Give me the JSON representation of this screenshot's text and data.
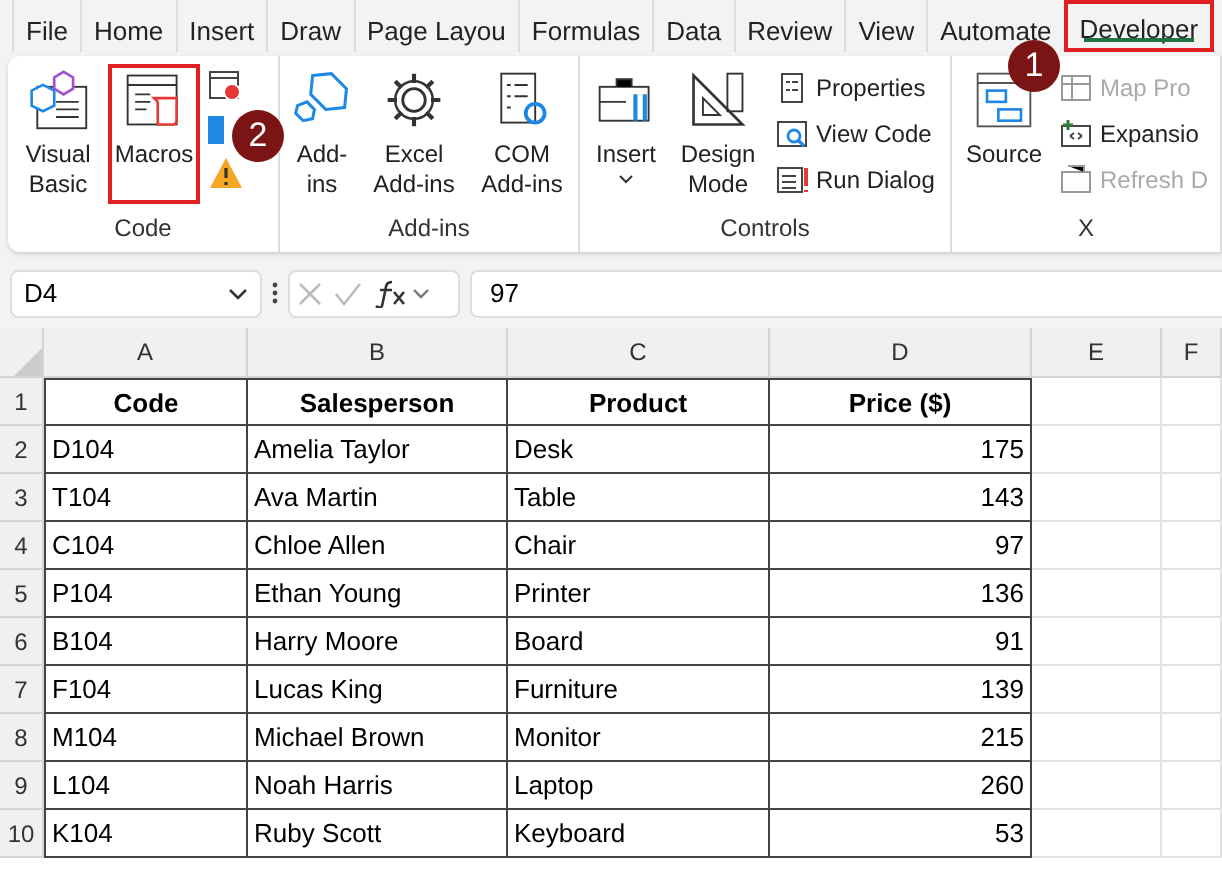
{
  "ribbon_tabs": [
    {
      "label": "File",
      "selected": false
    },
    {
      "label": "Home",
      "selected": false
    },
    {
      "label": "Insert",
      "selected": false
    },
    {
      "label": "Draw",
      "selected": false
    },
    {
      "label": "Page Layou",
      "selected": false
    },
    {
      "label": "Formulas",
      "selected": false
    },
    {
      "label": "Data",
      "selected": false
    },
    {
      "label": "Review",
      "selected": false
    },
    {
      "label": "View",
      "selected": false
    },
    {
      "label": "Automate",
      "selected": false
    },
    {
      "label": "Developer",
      "selected": true,
      "highlighted": true,
      "callout": "1"
    }
  ],
  "ribbon_groups": [
    {
      "label": "Code",
      "items": [
        {
          "kind": "large",
          "label": "Visual Basic"
        },
        {
          "kind": "large",
          "label": "Macros",
          "highlighted": true,
          "callout": "2"
        },
        {
          "kind": "iconstack"
        }
      ]
    },
    {
      "label": "Add-ins",
      "items": [
        {
          "kind": "large",
          "label": "Add-ins"
        },
        {
          "kind": "large",
          "label": "Excel Add-ins"
        },
        {
          "kind": "large",
          "label": "COM Add-ins"
        }
      ]
    },
    {
      "label": "Controls",
      "items": [
        {
          "kind": "large",
          "label": "Insert",
          "dropdown": true
        },
        {
          "kind": "large",
          "label": "Design Mode"
        },
        {
          "kind": "small",
          "entries": [
            {
              "label": "Properties",
              "disabled": false
            },
            {
              "label": "View Code",
              "disabled": false
            },
            {
              "label": "Run Dialog",
              "disabled": false
            }
          ]
        }
      ]
    },
    {
      "label": "X",
      "items": [
        {
          "kind": "large",
          "label": "Source"
        },
        {
          "kind": "small",
          "entries": [
            {
              "label": "Map Pro",
              "disabled": true
            },
            {
              "label": "Expansio",
              "disabled": false
            },
            {
              "label": "Refresh D",
              "disabled": true
            }
          ]
        }
      ]
    }
  ],
  "formula_bar": {
    "name_box": "D4",
    "formula": "97"
  },
  "sheet": {
    "columns": [
      "A",
      "B",
      "C",
      "D",
      "E",
      "F"
    ],
    "rows": [
      {
        "number": "1",
        "cells": [
          "Code",
          "Salesperson",
          "Product",
          "Price ($)"
        ]
      },
      {
        "number": "2",
        "cells": [
          "D104",
          "Amelia Taylor",
          "Desk",
          "175"
        ]
      },
      {
        "number": "3",
        "cells": [
          "T104",
          "Ava Martin",
          "Table",
          "143"
        ]
      },
      {
        "number": "4",
        "cells": [
          "C104",
          "Chloe Allen",
          "Chair",
          "97"
        ]
      },
      {
        "number": "5",
        "cells": [
          "P104",
          "Ethan Young",
          "Printer",
          "136"
        ]
      },
      {
        "number": "6",
        "cells": [
          "B104",
          "Harry Moore",
          "Board",
          "91"
        ]
      },
      {
        "number": "7",
        "cells": [
          "F104",
          "Lucas King",
          "Furniture",
          "139"
        ]
      },
      {
        "number": "8",
        "cells": [
          "M104",
          "Michael Brown",
          "Monitor",
          "215"
        ]
      },
      {
        "number": "9",
        "cells": [
          "L104",
          "Noah Harris",
          "Laptop",
          "260"
        ]
      },
      {
        "number": "10",
        "cells": [
          "K104",
          "Ruby Scott",
          "Keyboard",
          "53"
        ]
      }
    ]
  }
}
